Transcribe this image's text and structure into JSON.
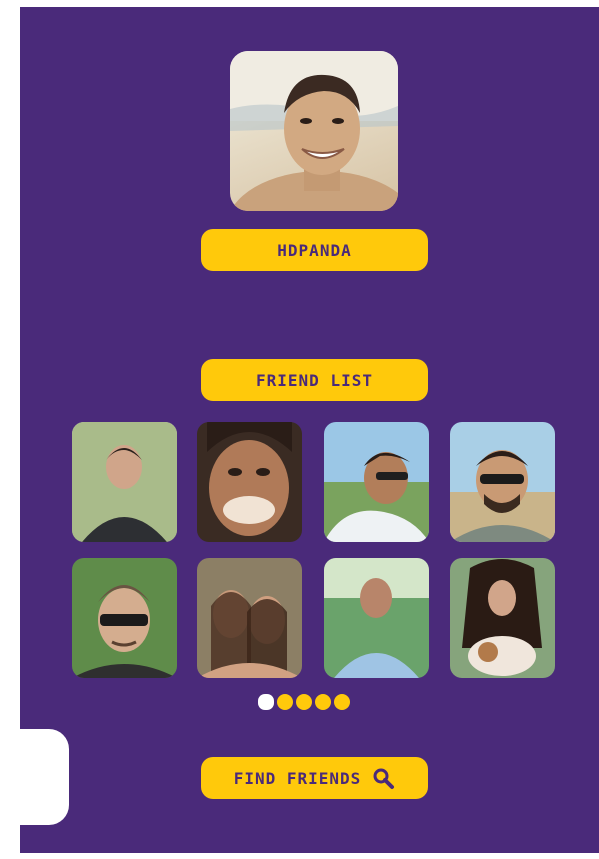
{
  "profile": {
    "username": "HDPANDA",
    "avatar_icon": "profile-photo"
  },
  "friends_section": {
    "title": "FRIEND LIST",
    "friends": [
      {
        "id": "f1",
        "icon": "avatar"
      },
      {
        "id": "f2",
        "icon": "avatar"
      },
      {
        "id": "f3",
        "icon": "avatar"
      },
      {
        "id": "f4",
        "icon": "avatar"
      },
      {
        "id": "f5",
        "icon": "avatar"
      },
      {
        "id": "f6",
        "icon": "avatar"
      },
      {
        "id": "f7",
        "icon": "avatar"
      },
      {
        "id": "f8",
        "icon": "avatar"
      }
    ]
  },
  "pagination": {
    "pages": 5,
    "active_page": 1
  },
  "actions": {
    "find_friends_label": "FIND FRIENDS",
    "search_icon": "search-icon"
  },
  "colors": {
    "background": "#4a2a7a",
    "accent": "#ffc90b",
    "text_on_accent": "#4a2a7a"
  }
}
